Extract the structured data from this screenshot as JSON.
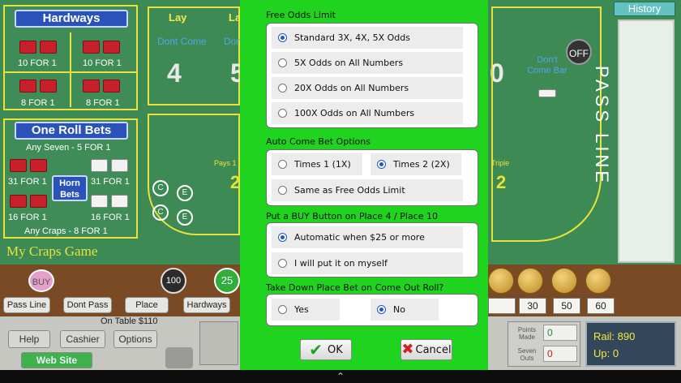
{
  "table": {
    "hardways_title": "Hardways",
    "hardways": [
      "10 FOR 1",
      "10 FOR 1",
      "8 FOR 1",
      "8 FOR 1"
    ],
    "one_roll_title": "One Roll Bets",
    "any_seven": "Any Seven - 5 FOR 1",
    "one_roll_odds": [
      "31 FOR 1",
      "31 FOR 1",
      "16 FOR 1",
      "16 FOR 1"
    ],
    "horn_label": "Horn Bets",
    "any_craps": "Any Craps - 8 FOR 1",
    "game_title": "My Craps Game",
    "lay_1": "Lay",
    "lay_2": "La",
    "dont_come_1": "Dont Come",
    "dont_come_2": "Don",
    "place_num_1": "4",
    "place_num_2": "5",
    "place_num_right": "0",
    "dont_come_bar": "Don't Come Bar",
    "off_label": "OFF",
    "pass_line": "PASS LINE",
    "history": "History",
    "pays_1": "Pays 1",
    "triple": "Triple",
    "field_2a": "2",
    "field_2b": "2",
    "ce_c": "C",
    "ce_e": "E"
  },
  "rail": {
    "buy": "BUY",
    "chip_100": "100",
    "chip_25": "25",
    "bets": [
      "Pass Line",
      "Dont Pass",
      "Place",
      "Hardways"
    ],
    "on_table": "On Table $110",
    "help": "Help",
    "cashier": "Cashier",
    "options": "Options",
    "website": "Web Site",
    "numbers": [
      "30",
      "50",
      "60"
    ],
    "points_made_label": "Points Made",
    "points_made": "0",
    "seven_outs_label": "Seven Outs",
    "seven_outs": "0",
    "rail_amount": "Rail: 890",
    "up_amount": "Up: 0"
  },
  "dialog": {
    "free_odds": {
      "title": "Free Odds Limit",
      "options": [
        "Standard 3X, 4X, 5X Odds",
        "5X Odds on All Numbers",
        "20X Odds on All Numbers",
        "100X Odds on All Numbers"
      ],
      "selected": 0
    },
    "auto_come": {
      "title": "Auto Come Bet Options",
      "options": [
        "Times 1 (1X)",
        "Times 2 (2X)",
        "Same as Free Odds Limit"
      ],
      "selected": 1
    },
    "buy_button": {
      "title": "Put a BUY Button on Place 4 / Place 10",
      "options": [
        "Automatic when $25 or more",
        "I will put it on myself"
      ],
      "selected": 0
    },
    "take_down": {
      "title": "Take Down Place Bet on Come Out Roll?",
      "options": [
        "Yes",
        "No"
      ],
      "selected": 1
    },
    "ok_label": "OK",
    "cancel_label": "Cancel"
  }
}
